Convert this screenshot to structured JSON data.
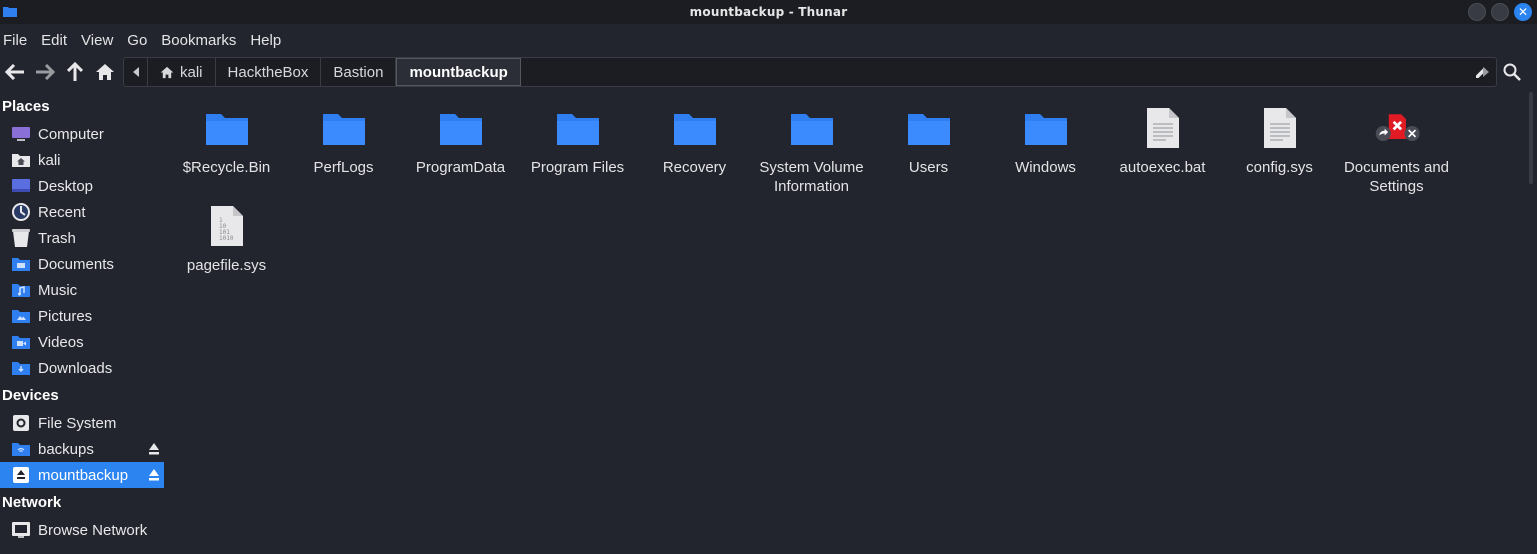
{
  "window": {
    "title": "mountbackup - Thunar"
  },
  "menubar": {
    "items": [
      "File",
      "Edit",
      "View",
      "Go",
      "Bookmarks",
      "Help"
    ]
  },
  "pathbar": {
    "crumbs": [
      "kali",
      "HacktheBox",
      "Bastion",
      "mountbackup"
    ],
    "active_index": 3
  },
  "sidebar": {
    "places_header": "Places",
    "places": [
      {
        "label": "Computer",
        "icon": "computer-icon"
      },
      {
        "label": "kali",
        "icon": "home-folder-icon"
      },
      {
        "label": "Desktop",
        "icon": "desktop-icon"
      },
      {
        "label": "Recent",
        "icon": "recent-icon"
      },
      {
        "label": "Trash",
        "icon": "trash-icon"
      },
      {
        "label": "Documents",
        "icon": "documents-folder-icon"
      },
      {
        "label": "Music",
        "icon": "music-folder-icon"
      },
      {
        "label": "Pictures",
        "icon": "pictures-folder-icon"
      },
      {
        "label": "Videos",
        "icon": "videos-folder-icon"
      },
      {
        "label": "Downloads",
        "icon": "downloads-folder-icon"
      }
    ],
    "devices_header": "Devices",
    "devices": [
      {
        "label": "File System",
        "icon": "drive-icon"
      },
      {
        "label": "backups",
        "icon": "network-folder-icon",
        "eject": true
      },
      {
        "label": "mountbackup",
        "icon": "mounted-drive-icon",
        "eject": true,
        "selected": true
      }
    ],
    "network_header": "Network",
    "network": [
      {
        "label": "Browse Network",
        "icon": "network-icon"
      }
    ]
  },
  "files": [
    {
      "name": "$Recycle.Bin",
      "type": "folder"
    },
    {
      "name": "PerfLogs",
      "type": "folder"
    },
    {
      "name": "ProgramData",
      "type": "folder"
    },
    {
      "name": "Program Files",
      "type": "folder"
    },
    {
      "name": "Recovery",
      "type": "folder"
    },
    {
      "name": "System Volume Information",
      "type": "folder"
    },
    {
      "name": "Users",
      "type": "folder"
    },
    {
      "name": "Windows",
      "type": "folder"
    },
    {
      "name": "autoexec.bat",
      "type": "text"
    },
    {
      "name": "config.sys",
      "type": "text"
    },
    {
      "name": "Documents and Settings",
      "type": "broken-link"
    },
    {
      "name": "pagefile.sys",
      "type": "binary"
    }
  ],
  "colors": {
    "accent": "#2b84f0",
    "folder": "#2f7ff0",
    "background": "#23252e",
    "titlebar": "#1b1d23"
  }
}
